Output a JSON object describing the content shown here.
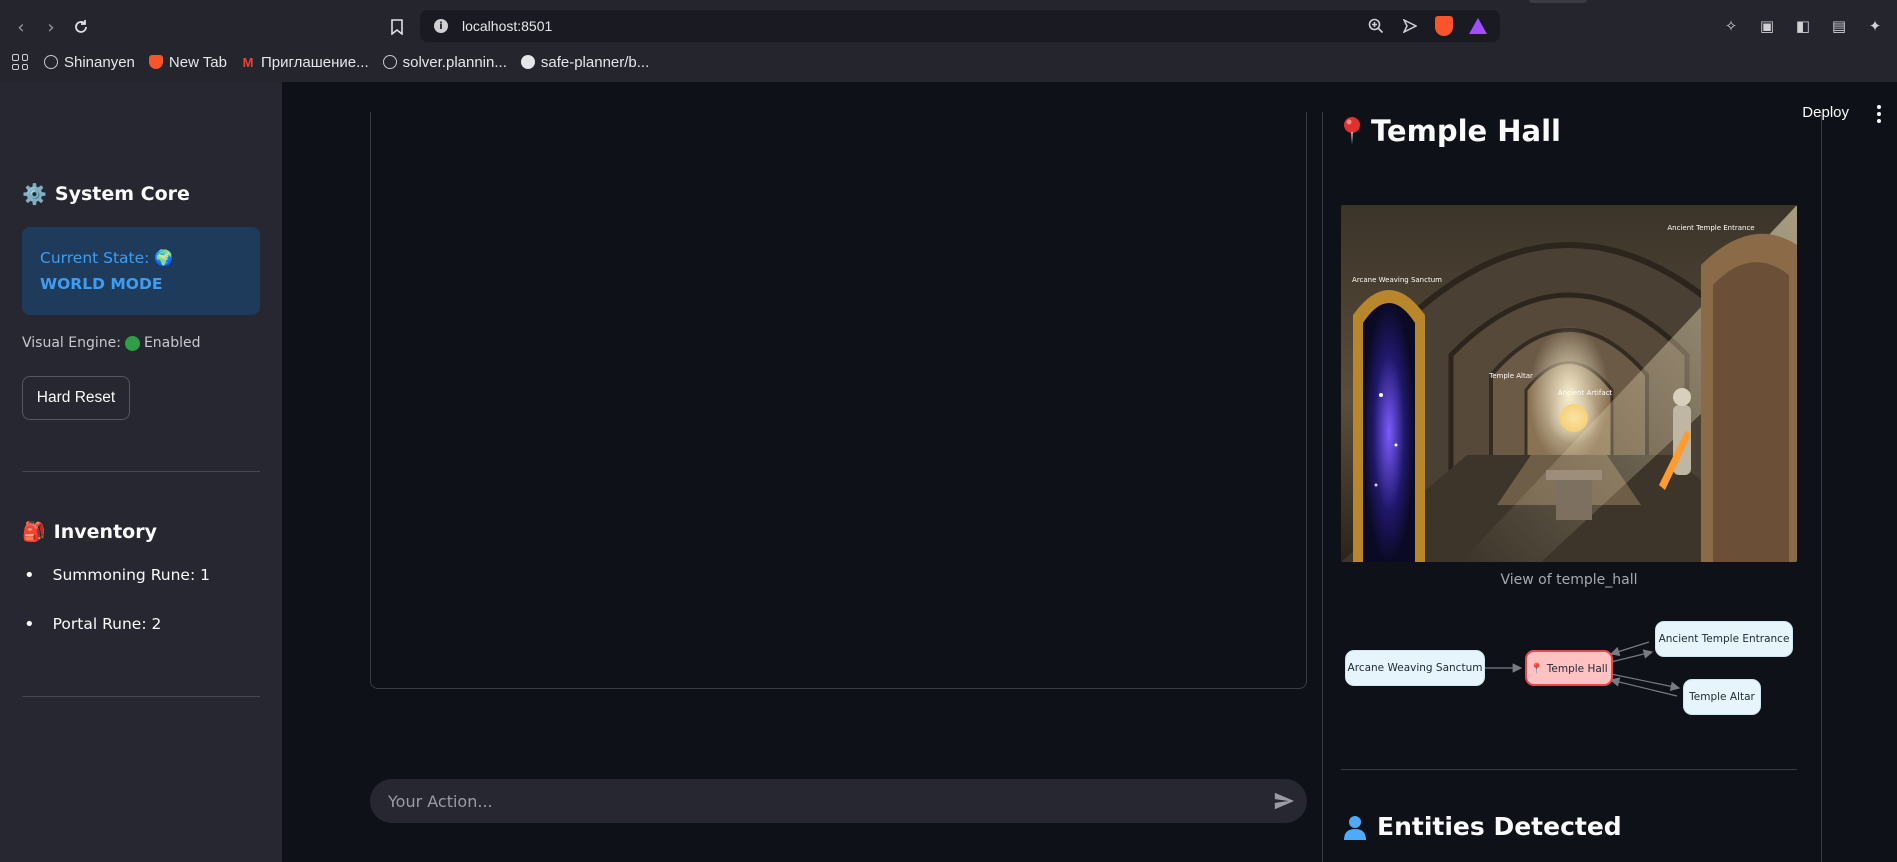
{
  "browser": {
    "url": "localhost:8501",
    "bookmarks": [
      {
        "label": "Shinanyen",
        "icon": "globe-icon"
      },
      {
        "label": "New Tab",
        "icon": "brave-icon"
      },
      {
        "label": "Приглашение...",
        "icon": "gmail-icon"
      },
      {
        "label": "solver.plannin...",
        "icon": "globe-icon"
      },
      {
        "label": "safe-planner/b...",
        "icon": "github-icon"
      }
    ]
  },
  "sidebar": {
    "system_title": "System Core",
    "state_label": "Current State: 🌍",
    "state_value": "WORLD MODE",
    "visual_label": "Visual Engine:",
    "visual_value": "Enabled",
    "reset_label": "Hard Reset",
    "inventory_title": "Inventory",
    "inventory": [
      {
        "text": "Summoning Rune: 1"
      },
      {
        "text": "Portal Rune: 2"
      }
    ]
  },
  "header": {
    "deploy_label": "Deploy"
  },
  "chat": {
    "placeholder": "Your Action..."
  },
  "location": {
    "title": "Temple Hall",
    "scene_labels": {
      "sanctum": "Arcane Weaving Sanctum",
      "entrance": "Ancient Temple Entrance",
      "altar": "Temple Altar",
      "artifact": "Ancient Artifact"
    },
    "caption": "View of temple_hall",
    "graph": {
      "current": "📍 Temple Hall",
      "sanctum": "Arcane Weaving Sanctum",
      "entrance": "Ancient Temple Entrance",
      "altar": "Temple Altar"
    },
    "entities_title": "Entities Detected"
  },
  "colors": {
    "app_bg": "#0e1117",
    "sidebar_bg": "#262730",
    "state_bg": "#1f3b5c",
    "state_text": "#3d9df3",
    "current_node_bg": "#ffc2c2",
    "current_node_border": "#e5484d",
    "node_bg": "#e6f4fb"
  }
}
